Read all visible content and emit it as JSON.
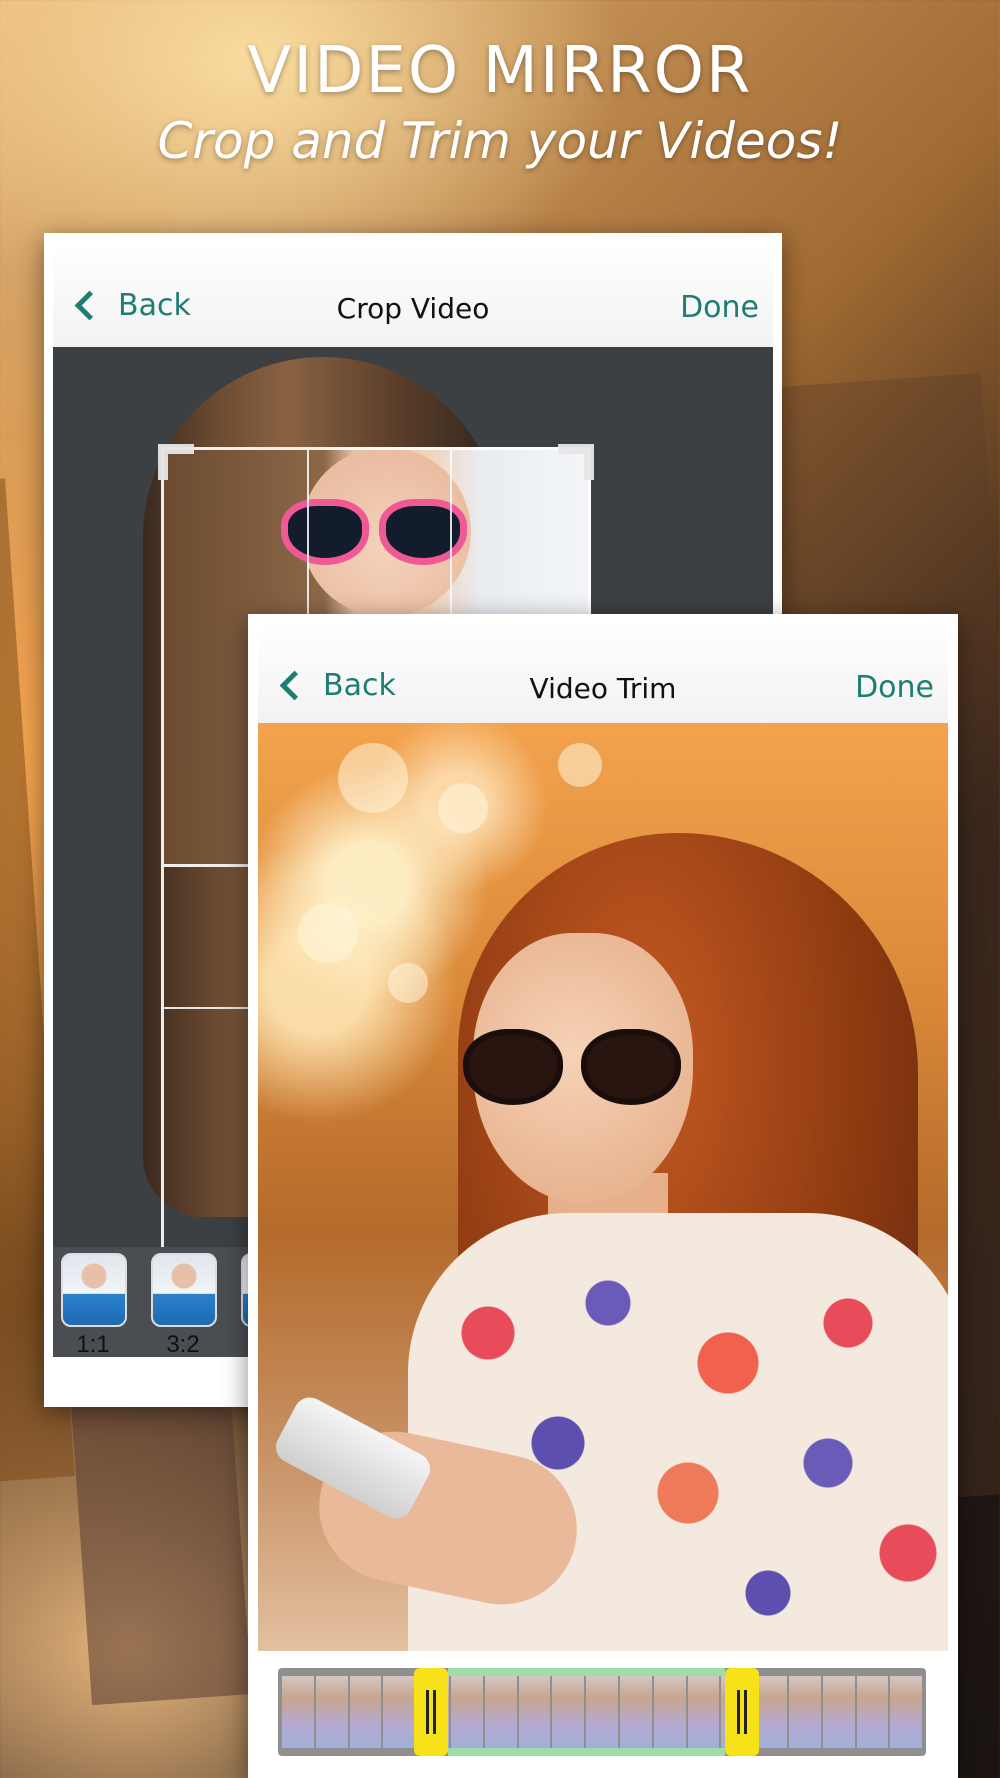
{
  "header": {
    "title": "VIDEO MIRROR",
    "subtitle": "Crop and Trim your Videos!"
  },
  "crop_screen": {
    "back_label": "Back",
    "title": "Crop Video",
    "done_label": "Done",
    "ratios": [
      {
        "label": "1:1"
      },
      {
        "label": "3:2"
      }
    ]
  },
  "trim_screen": {
    "back_label": "Back",
    "title": "Video Trim",
    "done_label": "Done",
    "trim_selection": {
      "start_fraction": 0.21,
      "end_fraction": 0.69
    }
  },
  "colors": {
    "accent": "#1f7d73",
    "handle": "#f7e21a",
    "selection": "#9fdca9"
  }
}
